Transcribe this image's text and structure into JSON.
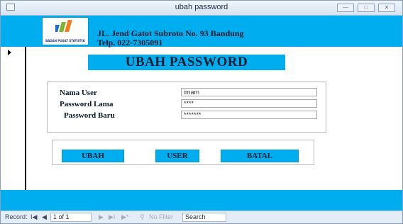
{
  "window": {
    "title": "ubah password",
    "controls": {
      "minimize": "—",
      "maximize": "□",
      "close": "✕"
    }
  },
  "header": {
    "logo_text": "BADAN PUSAT STATISTIK",
    "address_line1": "JL. Jend Gatot Subroto No. 93 Bandung",
    "address_line2": "Telp. 022-7305091"
  },
  "form": {
    "title": "UBAH PASSWORD",
    "fields": [
      {
        "label": "Nama User",
        "value": "imam"
      },
      {
        "label": "Password Lama",
        "value": "****"
      },
      {
        "label": "Password Baru",
        "value": "*******"
      }
    ],
    "buttons": {
      "ubah": "UBAH",
      "user": "USER",
      "batal": "BATAL"
    }
  },
  "navigation": {
    "record_label": "Record:",
    "first": "I◀",
    "prev": "◀",
    "position": "1 of 1",
    "next": "▶",
    "last": "▶I",
    "new": "▶*",
    "filter": "No Filter",
    "search": "Search"
  },
  "colors": {
    "accent": "#00aeef",
    "text": "#0a1a2e"
  }
}
